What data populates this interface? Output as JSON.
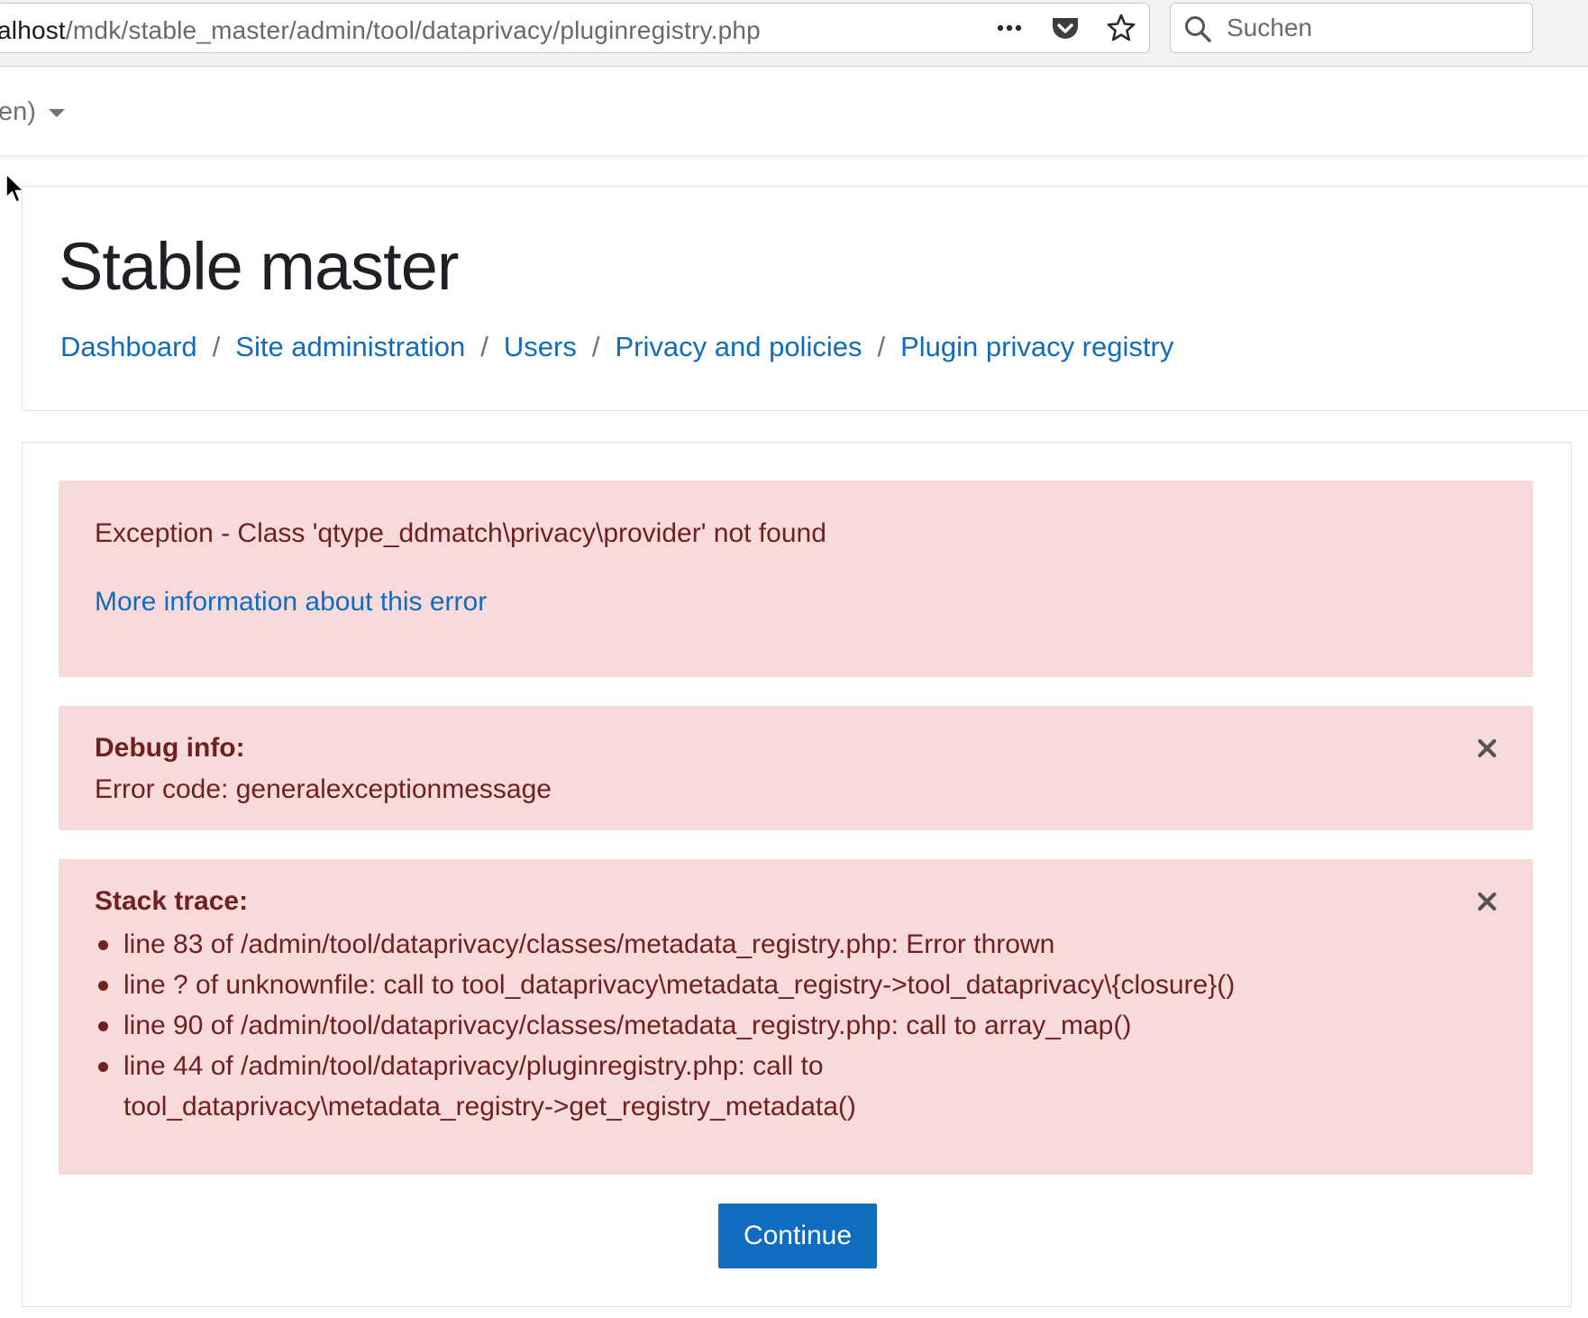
{
  "browser": {
    "url_host": "alhost",
    "url_path": "/mdk/stable_master/admin/tool/dataprivacy/pluginregistry.php",
    "search_placeholder": "Suchen",
    "icons": [
      "more-icon",
      "pocket-icon",
      "bookmark-star-icon",
      "search-icon"
    ]
  },
  "navbar": {
    "language_label": "en)"
  },
  "header": {
    "title": "Stable master",
    "breadcrumb": [
      {
        "label": "Dashboard"
      },
      {
        "label": "Site administration"
      },
      {
        "label": "Users"
      },
      {
        "label": "Privacy and policies"
      },
      {
        "label": "Plugin privacy registry"
      }
    ],
    "separator": "/"
  },
  "error": {
    "message": "Exception - Class 'qtype_ddmatch\\privacy\\provider' not found",
    "more_info_link": "More information about this error",
    "debug": {
      "heading": "Debug info:",
      "code_line": "Error code: generalexceptionmessage"
    },
    "stack_trace": {
      "heading": "Stack trace:",
      "lines": [
        "line 83 of /admin/tool/dataprivacy/classes/metadata_registry.php: Error thrown",
        "line ? of unknownfile: call to tool_dataprivacy\\metadata_registry->tool_dataprivacy\\{closure}()",
        "line 90 of /admin/tool/dataprivacy/classes/metadata_registry.php: call to array_map()",
        "line 44 of /admin/tool/dataprivacy/pluginregistry.php: call to"
      ],
      "line4_continuation": "tool_dataprivacy\\metadata_registry->get_registry_metadata()"
    },
    "continue_label": "Continue"
  },
  "colors": {
    "link": "#0f6cbf",
    "alert_bg": "#f8dada",
    "alert_text": "#6e211e",
    "button_bg": "#0f6cbf"
  }
}
